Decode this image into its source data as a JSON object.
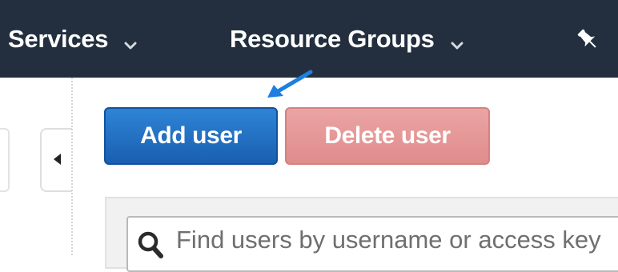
{
  "colors": {
    "nav_background": "#232f3e",
    "primary_button": "#1f6fc5",
    "danger_button_disabled": "#e59a9a",
    "annotation_arrow": "#1e7fe0"
  },
  "topnav": {
    "services_label": "Services",
    "resource_groups_label": "Resource Groups",
    "services_icon": "chevron-down-icon",
    "resource_groups_icon": "chevron-down-icon",
    "pin_icon": "pushpin-icon"
  },
  "side_panel": {
    "collapse_icon": "triangle-left-icon"
  },
  "actions": {
    "add_user_label": "Add user",
    "delete_user_label": "Delete user"
  },
  "search": {
    "icon": "search-icon",
    "placeholder": "Find users by username or access key",
    "value": ""
  }
}
